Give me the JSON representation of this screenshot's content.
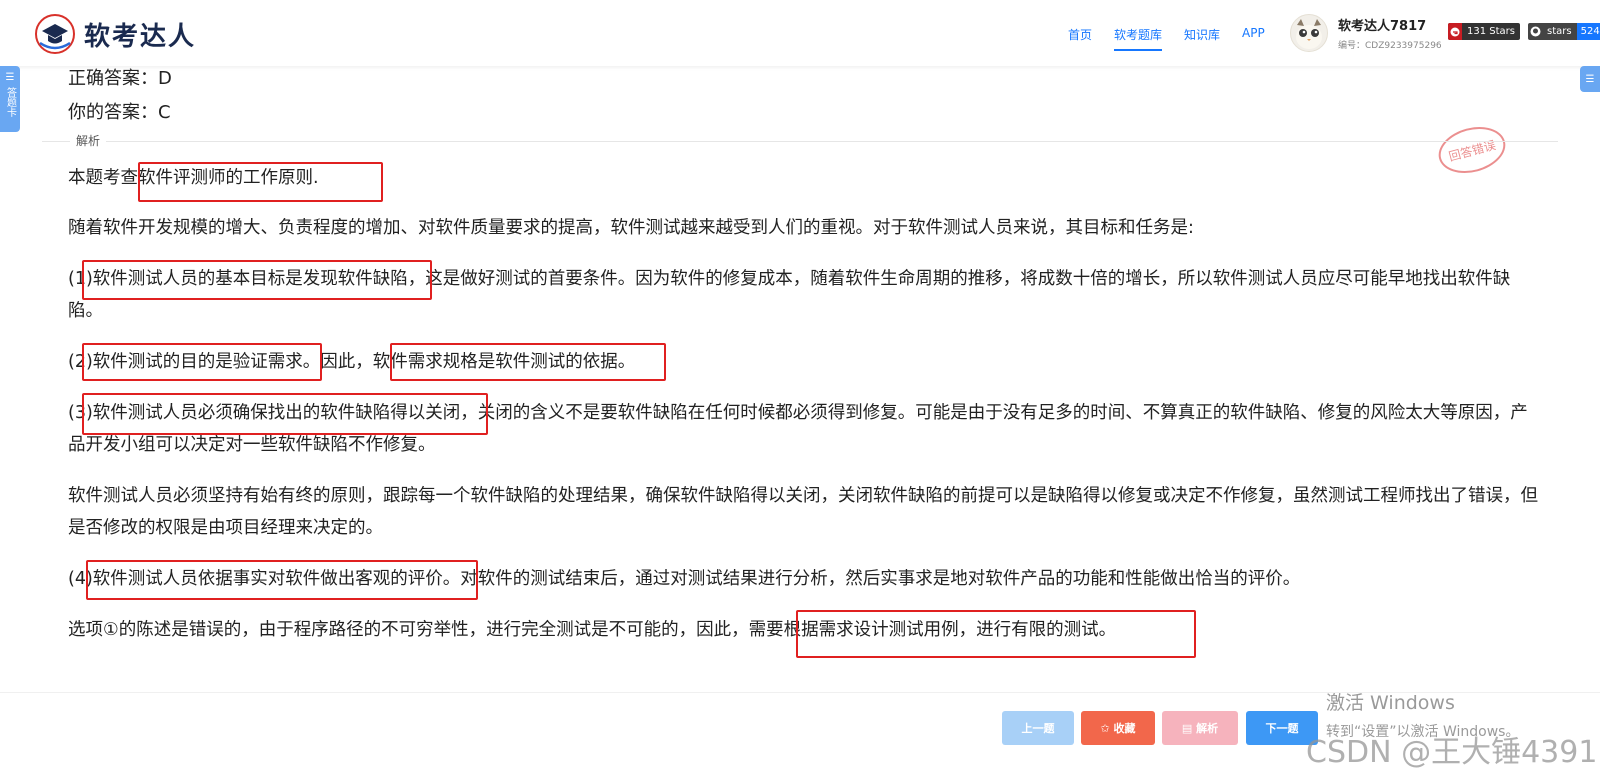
{
  "header": {
    "logo_text": "软考达人",
    "nav": [
      {
        "label": "首页",
        "active": false
      },
      {
        "label": "软考题库",
        "active": true
      },
      {
        "label": "知识库",
        "active": false
      },
      {
        "label": "APP",
        "active": false
      }
    ],
    "user_name": "软考达人7817",
    "user_id": "编号：CDZ9233975296",
    "gitee_badge": "131 Stars",
    "github_badge_label": "stars",
    "github_badge_count": "524"
  },
  "side_left": {
    "label": "答题卡"
  },
  "answer": {
    "correct": "正确答案：D",
    "mine": "你的答案：C",
    "stamp": "回答错误"
  },
  "analysis_label": "解析",
  "paragraphs": [
    "本题考查软件评测师的工作原则.",
    "随着软件开发规模的增大、负责程度的增加、对软件质量要求的提高，软件测试越来越受到人们的重视。对于软件测试人员来说，其目标和任务是:",
    "(1)软件测试人员的基本目标是发现软件缺陷，这是做好测试的首要条件。因为软件的修复成本，随着软件生命周期的推移，将成数十倍的增长，所以软件测试人员应尽可能早地找出软件缺陷。",
    "(2)软件测试的目的是验证需求。因此，软件需求规格是软件测试的依据。",
    "(3)软件测试人员必须确保找出的软件缺陷得以关闭，关闭的含义不是要软件缺陷在任何时候都必须得到修复。可能是由于没有足多的时间、不算真正的软件缺陷、修复的风险太大等原因，产品开发小组可以决定对一些软件缺陷不作修复。",
    "软件测试人员必须坚持有始有终的原则，跟踪每一个软件缺陷的处理结果，确保软件缺陷得以关闭，关闭软件缺陷的前提可以是缺陷得以修复或决定不作修复，虽然测试工程师找出了错误，但是否修改的权限是由项目经理来决定的。",
    "(4)软件测试人员依据事实对软件做出客观的评价。对软件的测试结束后，通过对测试结果进行分析，然后实事求是地对软件产品的功能和性能做出恰当的评价。",
    "选项①的陈述是错误的，由于程序路径的不可穷举性，进行完全测试是不可能的，因此，需要根据需求设计测试用例，进行有限的测试。"
  ],
  "footer": {
    "prev": "上一题",
    "fav": "✩ 收藏",
    "analysis": "▤ 解析",
    "next": "下一题"
  },
  "watermark": {
    "title": "激活 Windows",
    "sub": "转到“设置”以激活 Windows。",
    "csdn": "CSDN @王大锤4391"
  },
  "colors": {
    "accent": "#1677ff",
    "highlight_box": "#e02020",
    "stamp": "#e87c7c"
  }
}
